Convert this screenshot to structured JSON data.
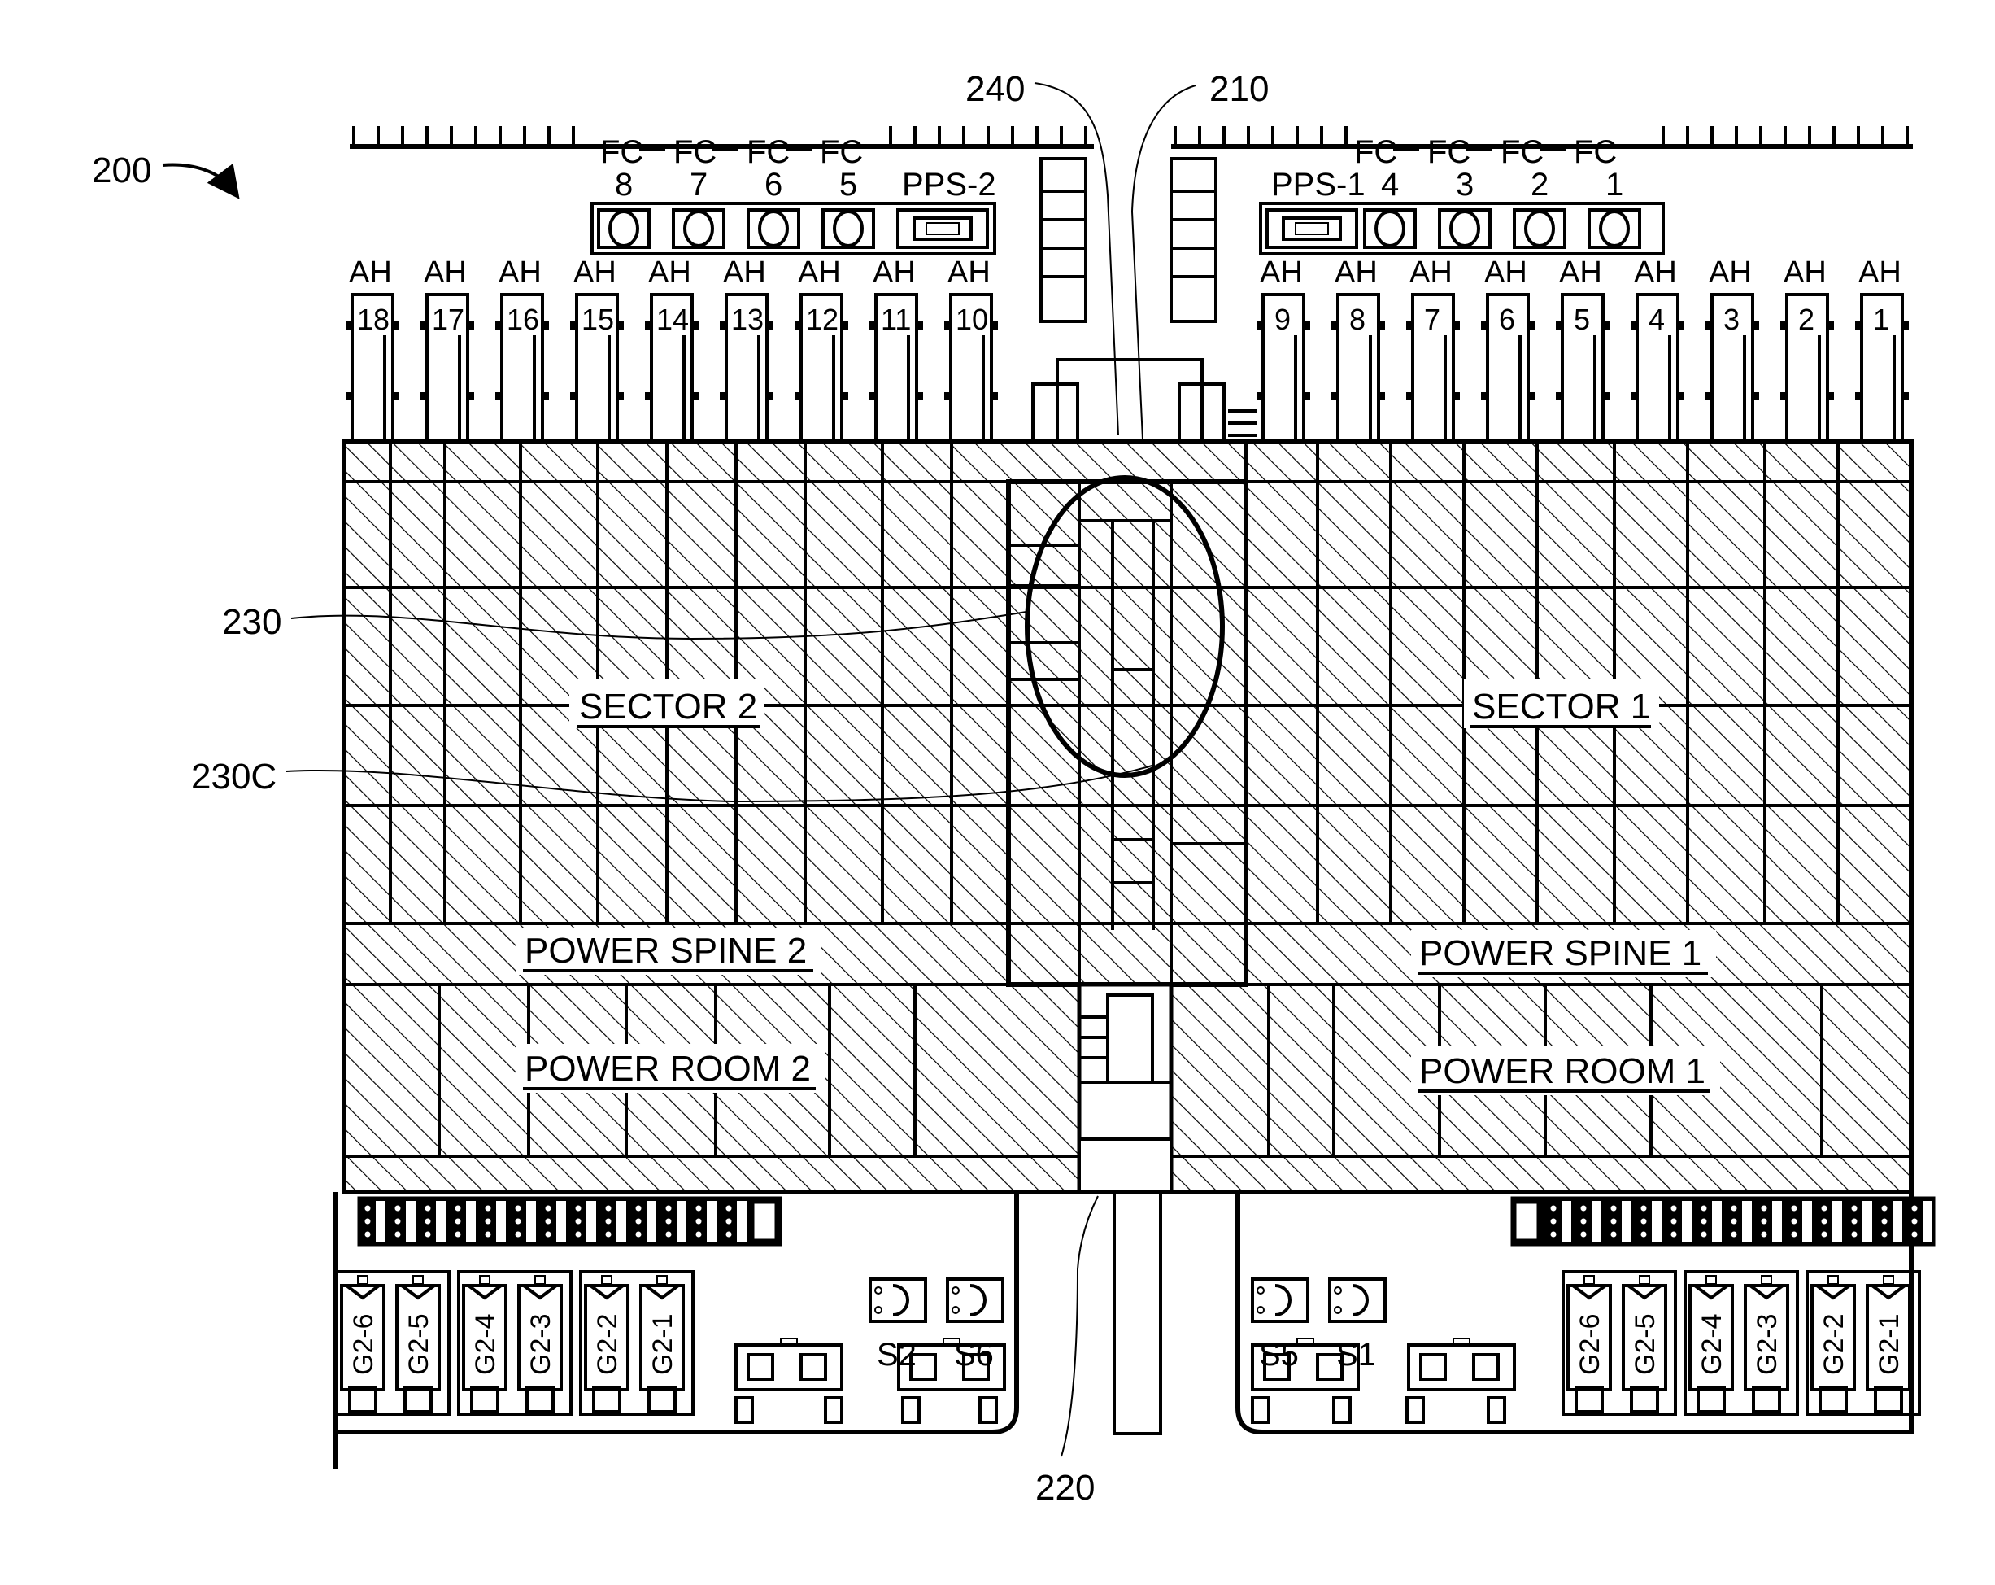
{
  "figure": {
    "reference_numeral": "200",
    "callouts": [
      {
        "id": "240",
        "text": "240"
      },
      {
        "id": "210",
        "text": "210"
      },
      {
        "id": "230",
        "text": "230"
      },
      {
        "id": "230C",
        "text": "230C"
      },
      {
        "id": "220",
        "text": "220"
      }
    ],
    "zones": {
      "sector_2": "SECTOR 2",
      "sector_1": "SECTOR 1",
      "power_spine_2": "POWER SPINE 2",
      "power_spine_1": "POWER SPINE 1",
      "power_room_2": "POWER ROOM 2",
      "power_room_1": "POWER ROOM 1"
    },
    "fluid_coolers_left": {
      "header": [
        "FC",
        "FC",
        "FC",
        "FC"
      ],
      "numbers": [
        "8",
        "7",
        "6",
        "5"
      ],
      "pump_station": "PPS-2"
    },
    "fluid_coolers_right": {
      "header": [
        "FC",
        "FC",
        "FC",
        "FC"
      ],
      "numbers": [
        "4",
        "3",
        "2",
        "1"
      ],
      "pump_station": "PPS-1"
    },
    "air_handlers_left": {
      "label": "AH",
      "units": [
        "18",
        "17",
        "16",
        "15",
        "14",
        "13",
        "12",
        "11",
        "10"
      ]
    },
    "air_handlers_right": {
      "label": "AH",
      "units": [
        "9",
        "8",
        "7",
        "6",
        "5",
        "4",
        "3",
        "2",
        "1"
      ]
    },
    "generators_left": [
      "G2-6",
      "G2-5",
      "G2-4",
      "G2-3",
      "G2-2",
      "G2-1"
    ],
    "generators_right": [
      "G2-6",
      "G2-5",
      "G2-4",
      "G2-3",
      "G2-2",
      "G2-1"
    ],
    "substations_left": [
      "S2",
      "S6"
    ],
    "substations_right": [
      "S5",
      "S1"
    ]
  }
}
